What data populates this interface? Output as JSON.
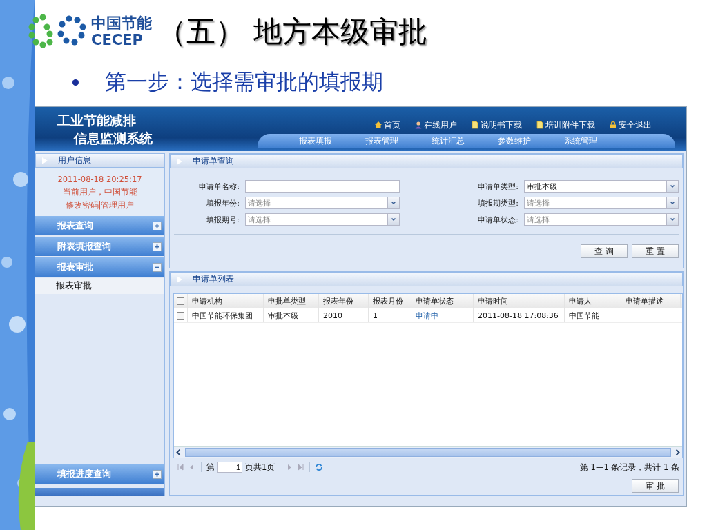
{
  "slide": {
    "logo": {
      "name_cn": "中国节能",
      "name_en": "CECEP"
    },
    "title": "（五） 地方本级审批",
    "bullet": "第一步：选择需审批的填报期"
  },
  "app": {
    "title_lines": [
      "工业节能减排",
      "信息监测系统"
    ],
    "top_links": [
      {
        "label": "首页",
        "kind": "home"
      },
      {
        "label": "在线用户",
        "kind": "user"
      },
      {
        "label": "说明书下载",
        "kind": "document"
      },
      {
        "label": "培训附件下载",
        "kind": "document"
      },
      {
        "label": "安全退出",
        "kind": "lock"
      }
    ],
    "nav": [
      "报表填报",
      "报表管理",
      "统计汇总",
      "参数维护",
      "系统管理"
    ],
    "sidebar": {
      "user_panel": {
        "title": "用户信息",
        "time": "2011-08-18 20:25:17",
        "user": "当前用户，中国节能",
        "links": [
          "修改密码",
          "管理用户"
        ],
        "separator": "|"
      },
      "sections": [
        {
          "label": "报表查询",
          "expanded": false
        },
        {
          "label": "附表填报查询",
          "expanded": false
        },
        {
          "label": "报表审批",
          "expanded": true,
          "children": [
            {
              "label": "报表审批"
            }
          ]
        }
      ],
      "footer_section": {
        "label": "填报进度查询",
        "expanded": false
      }
    },
    "query_panel": {
      "title": "申请单查询",
      "fields": [
        {
          "label": "申请单名称:",
          "kind": "text"
        },
        {
          "label": "申请单类型:",
          "kind": "select",
          "value": "审批本级"
        },
        {
          "label": "填报年份:",
          "kind": "select",
          "placeholder": "请选择"
        },
        {
          "label": "填报期类型:",
          "kind": "select",
          "placeholder": "请选择"
        },
        {
          "label": "填报期号:",
          "kind": "select",
          "placeholder": "请选择"
        },
        {
          "label": "申请单状态:",
          "kind": "select",
          "placeholder": "请选择"
        }
      ],
      "buttons": [
        "查 询",
        "重 置"
      ]
    },
    "list_panel": {
      "title": "申请单列表",
      "all_selected": false,
      "columns": [
        "申请机构",
        "申批单类型",
        "报表年份",
        "报表月份",
        "申请单状态",
        "申请时间",
        "申请人",
        "申请单描述"
      ],
      "rows": [
        {
          "selected": false,
          "cells": [
            "中国节能环保集团",
            "审批本级",
            "2010",
            "1",
            "申请中",
            "2011-08-18 17:08:36",
            "中国节能"
          ]
        }
      ],
      "pager": {
        "page_prefix": "第",
        "page": "1",
        "page_suffix": "页共1页",
        "summary": "第 1—1 条记录，共计 1 条"
      },
      "action_button": "审 批"
    }
  }
}
